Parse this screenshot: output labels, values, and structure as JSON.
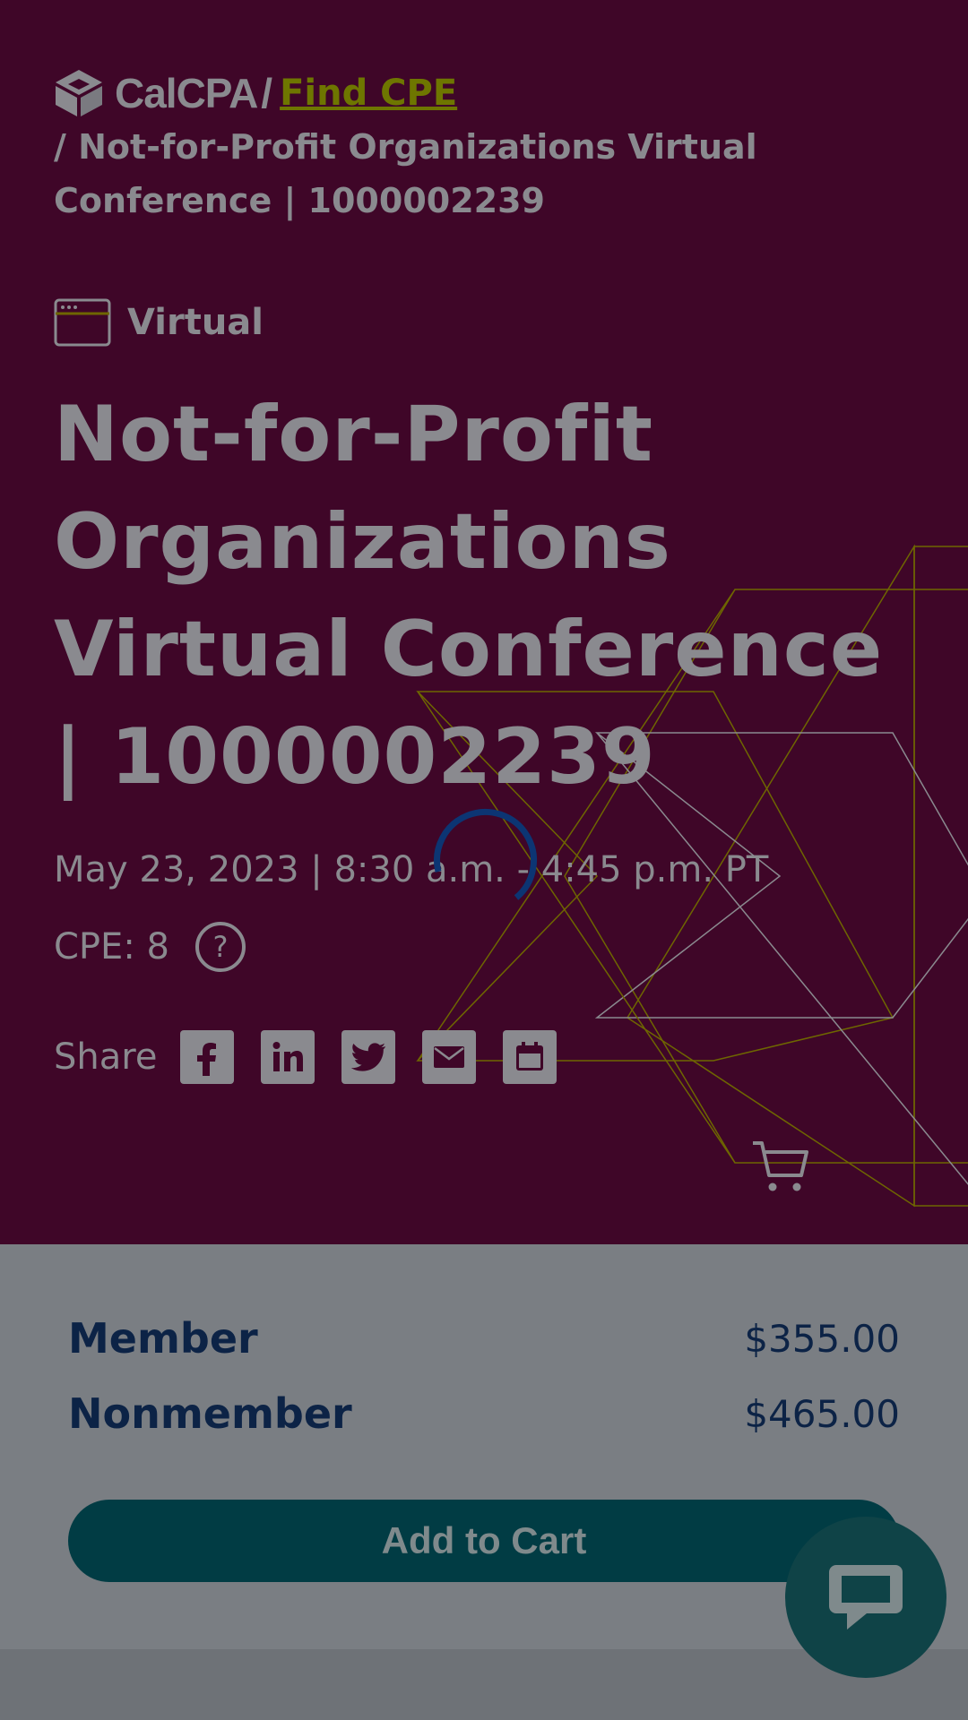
{
  "breadcrumb": {
    "logo_text": "CalCPA",
    "separator": "/",
    "find_cpe": "Find CPE",
    "current": "/ Not-for-Profit Organizations Virtual Conference | 1000002239"
  },
  "event": {
    "format_label": "Virtual",
    "format_icon": "browser-window-icon",
    "title": "Not-for-Profit Organizations Virtual Conference | 1000002239",
    "date_time": "May 23, 2023 | 8:30 a.m. - 4:45 p.m. PT",
    "cpe": "CPE: 8"
  },
  "share": {
    "label": "Share",
    "buttons": [
      "facebook-icon",
      "linkedin-icon",
      "twitter-icon",
      "email-icon",
      "calendar-icon"
    ]
  },
  "pricing": {
    "member_label": "Member",
    "member_price": "$355.00",
    "nonmember_label": "Nonmember",
    "nonmember_price": "$465.00",
    "add_to_cart": "Add to Cart"
  },
  "colors": {
    "hero_bg": "#3f0628",
    "link": "#6e7600",
    "button_bg": "#013c44",
    "price_text": "#0c2346",
    "overlay_text": "#8a8a8f"
  }
}
